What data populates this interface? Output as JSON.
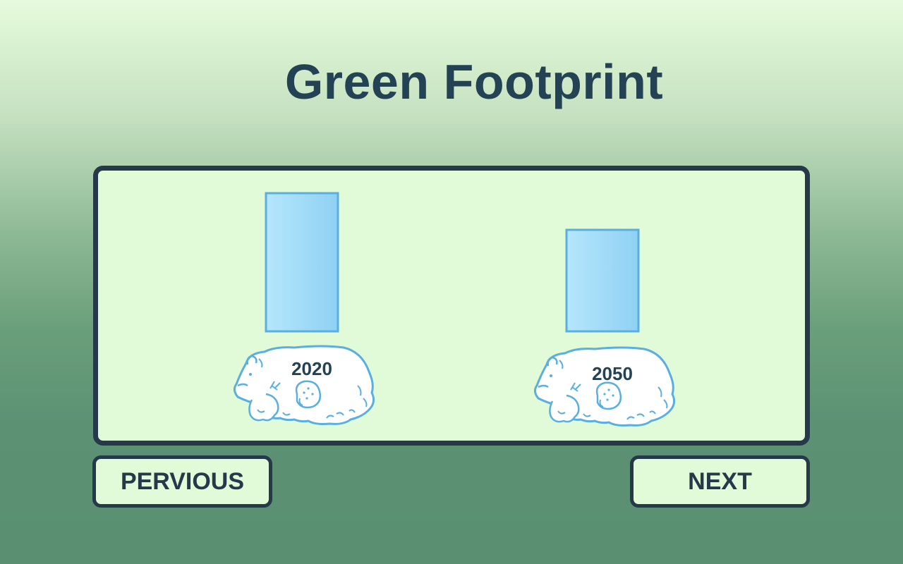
{
  "title": "Green Footprint",
  "chart_data": {
    "type": "bar",
    "categories": [
      "2020",
      "2050"
    ],
    "values": [
      196,
      144
    ],
    "ylim": [
      0,
      230
    ],
    "bar_fill": [
      "#a9e1fb",
      "#8fd1f3"
    ],
    "bar_stroke": "#5aaee0",
    "bear_stroke": "#5aaee0"
  },
  "nav": {
    "previous_label": "PERVIOUS",
    "next_label": "NEXT"
  }
}
